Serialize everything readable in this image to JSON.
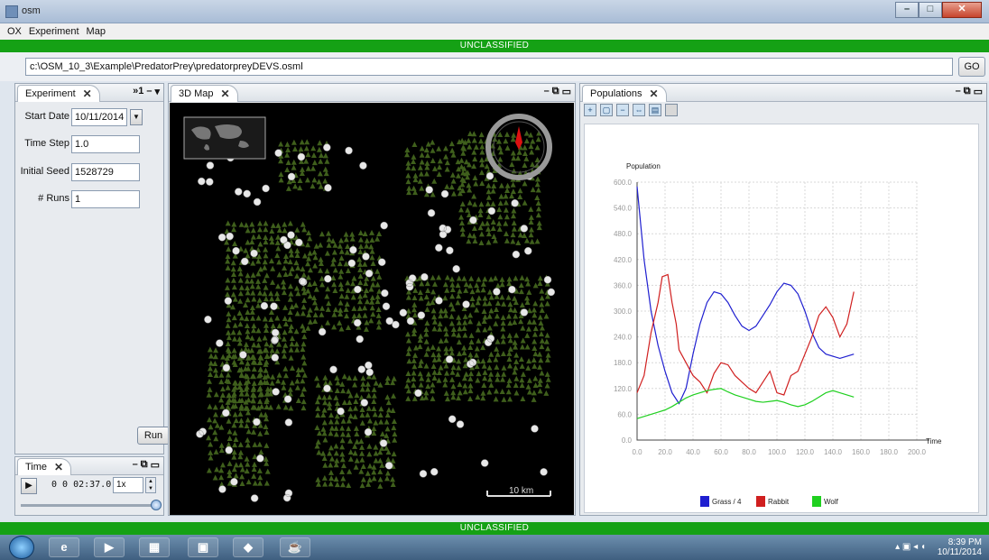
{
  "window": {
    "title": "osm"
  },
  "menu": [
    "OX",
    "Experiment",
    "Map"
  ],
  "banner": "UNCLASSIFIED",
  "pathbar": {
    "path": "c:\\OSM_10_3\\Example\\PredatorPrey\\predatorpreyDEVS.osml",
    "go_label": "GO"
  },
  "experiment_panel": {
    "tab": "Experiment",
    "tab_overflow": "»1",
    "start_date_label": "Start Date",
    "start_date": "10/11/2014",
    "time_step_label": "Time Step",
    "time_step": "1.0",
    "seed_label": "Initial Seed",
    "seed": "1528729",
    "runs_label": "# Runs",
    "runs": "1",
    "run_label": "Run"
  },
  "time_panel": {
    "tab": "Time",
    "clock": "0 0 02:37.0",
    "speed": "1x",
    "slider_value": 1.0
  },
  "map_panel": {
    "tab": "3D Map",
    "scale_label": "10 km"
  },
  "populations_panel": {
    "tab": "Populations"
  },
  "chart_data": {
    "type": "line",
    "title": "",
    "ylabel": "Population",
    "xlabel": "Time",
    "xlim": [
      0,
      200
    ],
    "ylim": [
      0,
      600
    ],
    "xticks": [
      "0.0",
      "20.0",
      "40.0",
      "60.0",
      "80.0",
      "100.0",
      "120.0",
      "140.0",
      "160.0",
      "180.0",
      "200.0"
    ],
    "yticks": [
      "0.0",
      "60.0",
      "120.0",
      "180.0",
      "240.0",
      "300.0",
      "360.0",
      "420.0",
      "480.0",
      "540.0",
      "600.0"
    ],
    "grid": true,
    "legend": "bottom",
    "series": [
      {
        "name": "Grass / 4",
        "color": "#1f1fd0",
        "x": [
          0,
          5,
          10,
          15,
          20,
          25,
          30,
          35,
          40,
          45,
          50,
          55,
          60,
          65,
          70,
          75,
          80,
          85,
          90,
          95,
          100,
          105,
          110,
          115,
          120,
          125,
          130,
          135,
          140,
          145,
          150,
          155
        ],
        "y": [
          590,
          420,
          300,
          220,
          160,
          110,
          85,
          120,
          200,
          270,
          320,
          345,
          340,
          320,
          290,
          265,
          255,
          265,
          290,
          315,
          345,
          365,
          360,
          340,
          300,
          250,
          215,
          200,
          195,
          190,
          195,
          200
        ]
      },
      {
        "name": "Rabbit",
        "color": "#d01f1f",
        "x": [
          0,
          5,
          10,
          15,
          18,
          22,
          25,
          28,
          30,
          35,
          40,
          45,
          50,
          55,
          60,
          65,
          70,
          75,
          80,
          85,
          90,
          95,
          100,
          105,
          110,
          115,
          120,
          125,
          130,
          135,
          140,
          145,
          150,
          155
        ],
        "y": [
          110,
          150,
          250,
          320,
          380,
          385,
          320,
          270,
          210,
          180,
          150,
          135,
          110,
          155,
          180,
          175,
          150,
          135,
          120,
          110,
          135,
          160,
          110,
          105,
          150,
          160,
          200,
          240,
          290,
          310,
          285,
          240,
          270,
          345
        ]
      },
      {
        "name": "Wolf",
        "color": "#1fd01f",
        "x": [
          0,
          5,
          10,
          15,
          20,
          25,
          30,
          35,
          40,
          45,
          50,
          55,
          60,
          65,
          70,
          75,
          80,
          85,
          90,
          95,
          100,
          105,
          110,
          115,
          120,
          125,
          130,
          135,
          140,
          145,
          150,
          155
        ],
        "y": [
          50,
          55,
          60,
          65,
          70,
          78,
          88,
          98,
          105,
          110,
          115,
          118,
          120,
          112,
          105,
          100,
          95,
          90,
          88,
          90,
          92,
          88,
          82,
          78,
          82,
          90,
          100,
          110,
          115,
          110,
          105,
          100
        ]
      }
    ]
  },
  "taskbar": {
    "time": "8:39 PM",
    "date": "10/11/2014"
  },
  "colors": {
    "banner": "#15a115",
    "grass": "#3f5f1c"
  }
}
